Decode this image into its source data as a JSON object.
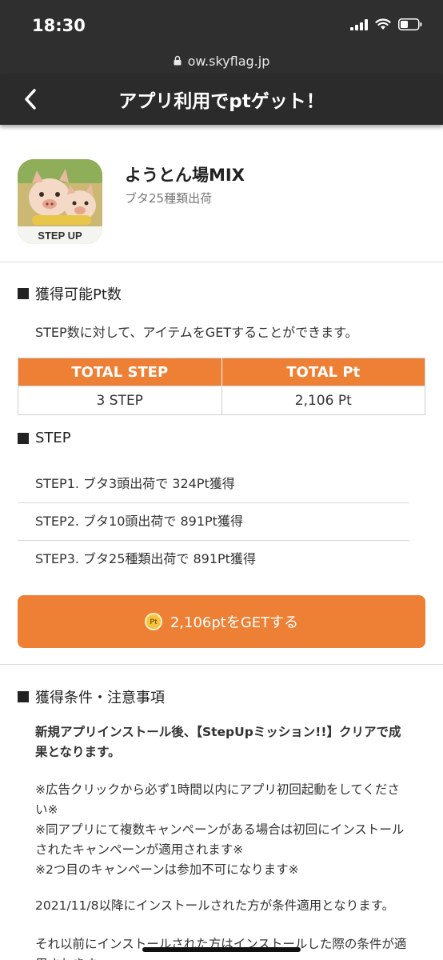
{
  "status_bar": {
    "time": "18:30"
  },
  "browser": {
    "url": "ow.skyflag.jp"
  },
  "nav": {
    "title": "アプリ利用でptゲット！"
  },
  "app": {
    "name": "ようとん場MIX",
    "subtitle": "ブタ25種類出荷",
    "icon_badge": "STEP UP"
  },
  "points_section": {
    "heading": "獲得可能Pt数",
    "description": "STEP数に対して、アイテムをGETすることができます。",
    "table": {
      "headers": [
        "TOTAL STEP",
        "TOTAL Pt"
      ],
      "row": [
        "3 STEP",
        "2,106 Pt"
      ]
    }
  },
  "step_section": {
    "heading": "STEP",
    "steps": [
      "STEP1. ブタ3頭出荷で 324Pt獲得",
      "STEP2. ブタ10頭出荷で 891Pt獲得",
      "STEP3. ブタ25種類出荷で 891Pt獲得"
    ]
  },
  "get_button": {
    "label": "2,106ptをGETする",
    "coin_text": "Pt"
  },
  "conditions_section": {
    "heading": "獲得条件・注意事項",
    "bold_note": "新規アプリインストール後、【StepUpミッション!!】クリアで成果となります。",
    "notes": [
      "※広告クリックから必ず1時間以内にアプリ初回起動をしてください※",
      "※同アプリにて複数キャンペーンがある場合は初回にインストールされたキャンペーンが適用されます※",
      "※2つ目のキャンペーンは参加不可になります※"
    ],
    "date_note": "2021/11/8以降にインストールされた方が条件適用となります。",
    "partial_note": "それ以前にインストールされた方はインストールした際の条件が適用されます。"
  },
  "colors": {
    "accent": "#ee8035",
    "status_bar": "#2f2f2f",
    "nav_bar": "#2b2b2b"
  }
}
